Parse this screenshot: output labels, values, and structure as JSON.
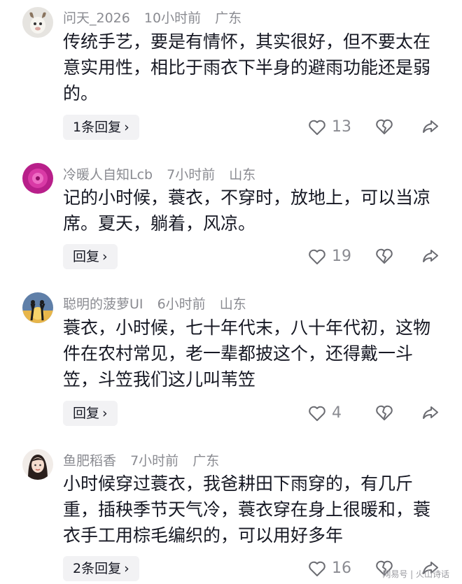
{
  "comments": [
    {
      "username": "问天_2026",
      "time": "10小时前",
      "location": "广东",
      "text": "传统手艺，要是有情怀，其实很好，但不要太在意实用性，相比于雨衣下半身的避雨功能还是弱的。",
      "reply_label": "1条回复",
      "likes": "13",
      "avatar": "goat-avatar"
    },
    {
      "username": "冷暖人自知Lcb",
      "time": "7小时前",
      "location": "山东",
      "text": "记的小时候，蓑衣，不穿时，放地上，可以当凉席。夏天，躺着，风凉。",
      "reply_label": "回复",
      "likes": "19",
      "avatar": "flower-avatar"
    },
    {
      "username": "聪明的菠萝UI",
      "time": "6小时前",
      "location": "山东",
      "text": "蓑衣，小时候，七十年代末，八十年代初，这物件在农村常见，老一辈都披这个，还得戴一斗笠，斗笠我们这儿叫苇笠",
      "reply_label": "回复",
      "likes": "4",
      "avatar": "silhouette-avatar"
    },
    {
      "username": "鱼肥稻香",
      "time": "7小时前",
      "location": "广东",
      "text": "小时候穿过蓑衣，我爸耕田下雨穿的，有几斤重，插秧季节天气冷，蓑衣穿在身上很暖和，蓑衣手工用棕毛编织的，可以用好多年",
      "reply_label": "2条回复",
      "likes": "16",
      "avatar": "portrait-avatar"
    }
  ],
  "reply_chevron": "›",
  "watermark": "网易号 | 火山诗话",
  "icons": {
    "like": "heart-icon",
    "dislike": "broken-heart-icon",
    "share": "share-arrow-icon"
  }
}
